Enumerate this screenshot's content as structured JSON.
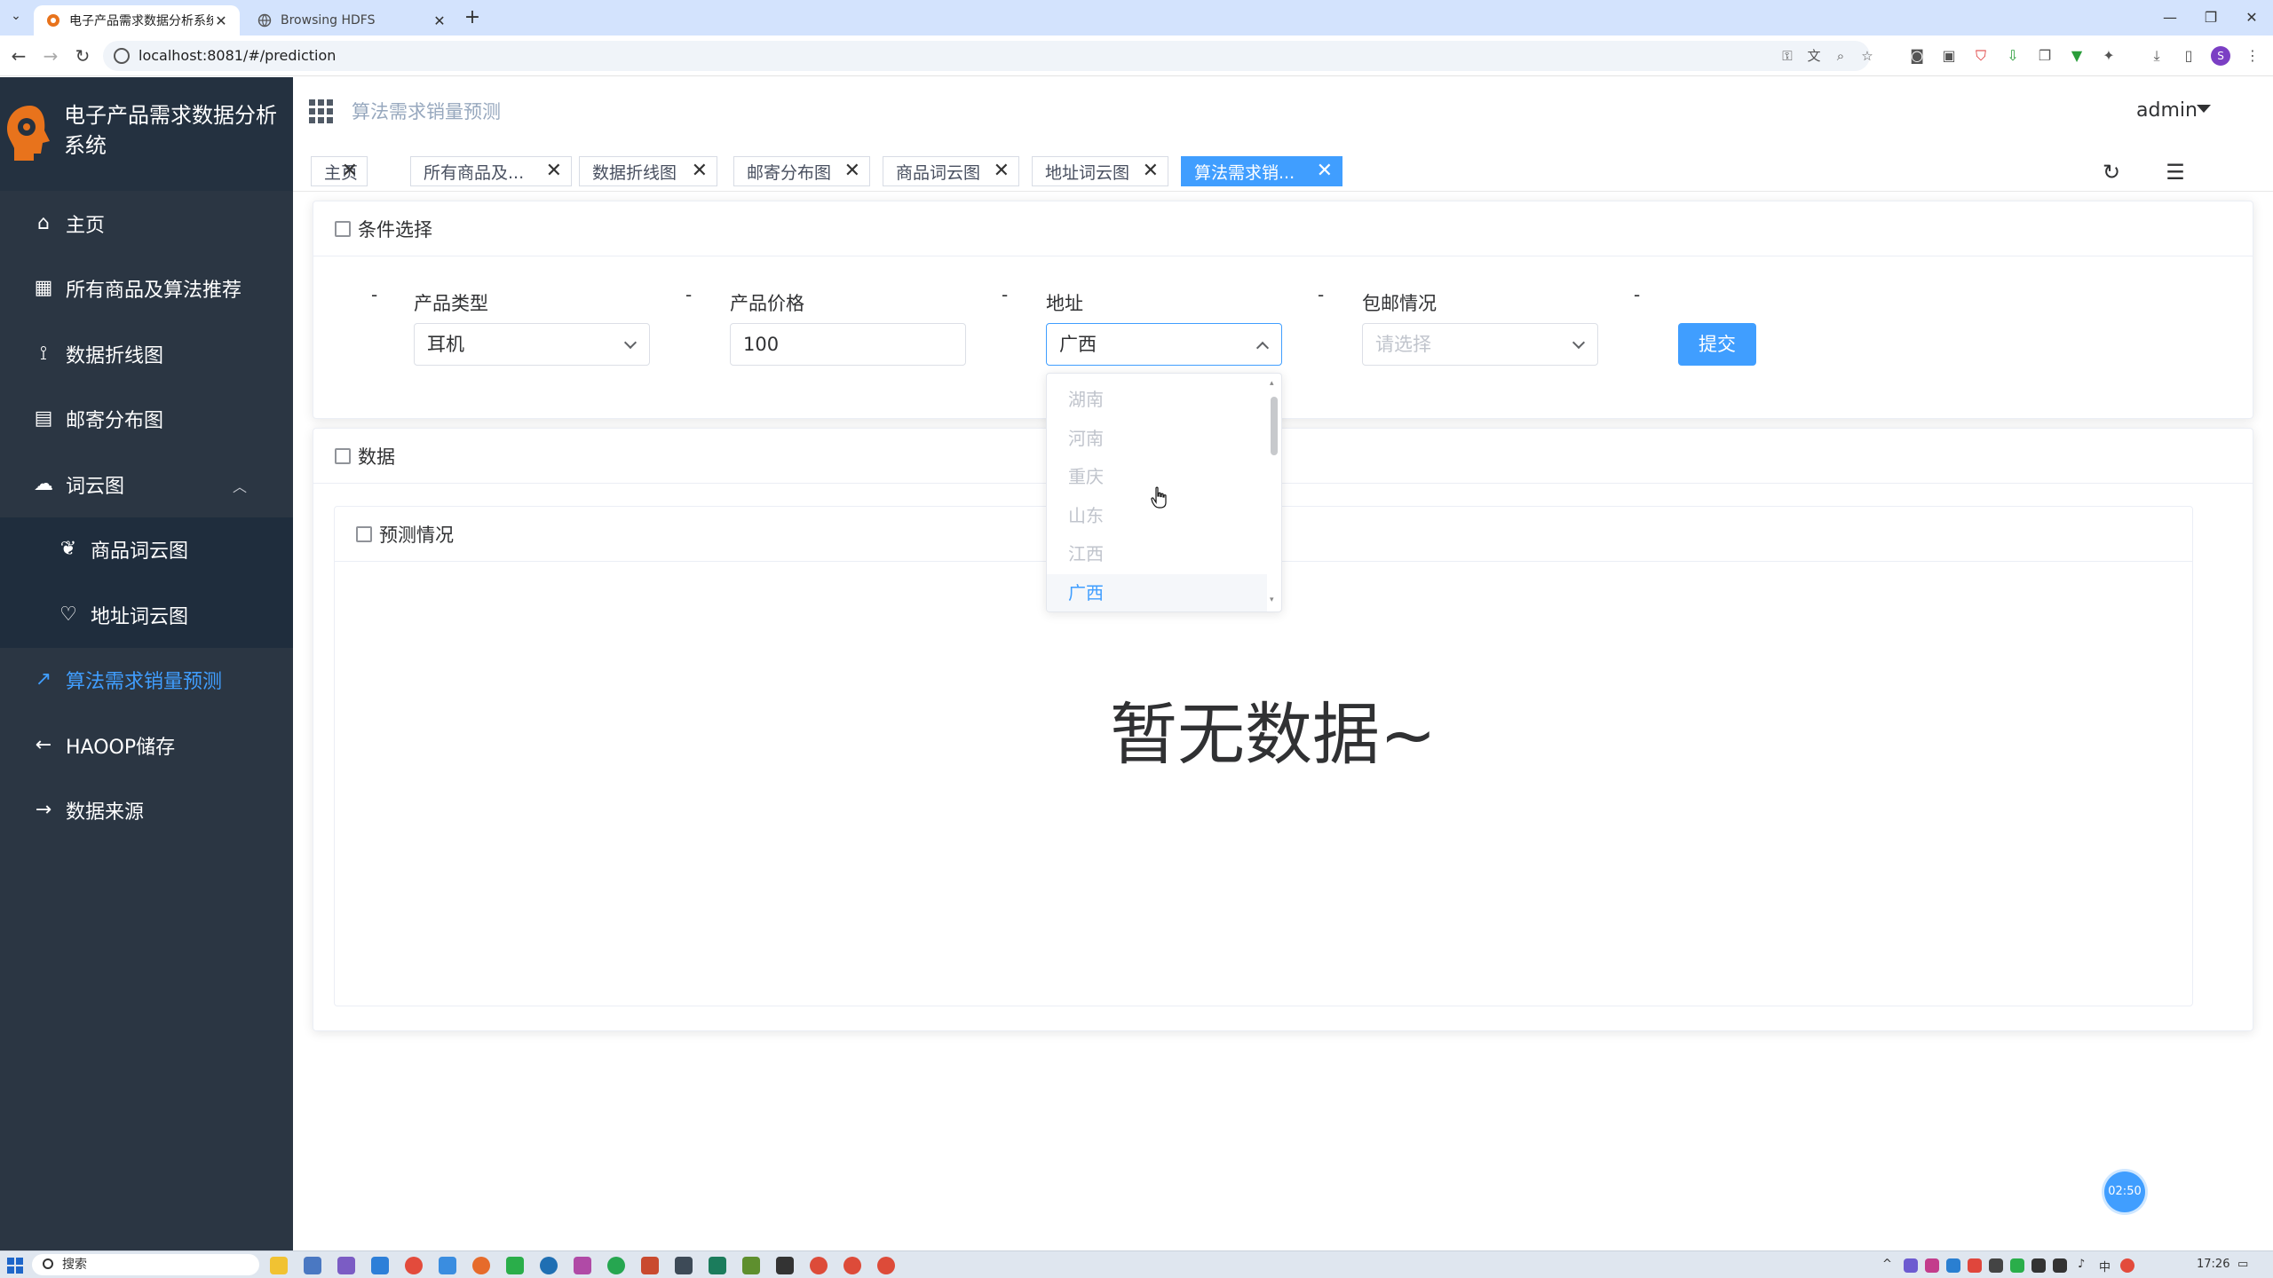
{
  "browser": {
    "tabs": [
      {
        "title": "电子产品需求数据分析系统 - 算",
        "active": true
      },
      {
        "title": "Browsing HDFS",
        "active": false
      }
    ],
    "url": "localhost:8081/#/prediction"
  },
  "app": {
    "title": "电子产品需求数据分析系统",
    "breadcrumb": "算法需求销量预测",
    "user": "admin"
  },
  "sidebar": {
    "items": [
      {
        "label": "主页",
        "icon": "home-icon"
      },
      {
        "label": "所有商品及算法推荐",
        "icon": "grid-icon"
      },
      {
        "label": "数据折线图",
        "icon": "share-icon"
      },
      {
        "label": "邮寄分布图",
        "icon": "box-icon"
      },
      {
        "label": "词云图",
        "icon": "cloud-icon"
      },
      {
        "label": "商品词云图",
        "icon": "leaf-icon"
      },
      {
        "label": "地址词云图",
        "icon": "heart-icon"
      },
      {
        "label": "算法需求销量预测",
        "icon": "trend-icon"
      },
      {
        "label": "HAOOP储存",
        "icon": "arrow-left-icon"
      },
      {
        "label": "数据来源",
        "icon": "arrow-right-icon"
      }
    ]
  },
  "tags": [
    "主页",
    "所有商品及...",
    "数据折线图",
    "邮寄分布图",
    "商品词云图",
    "地址词云图",
    "算法需求销..."
  ],
  "conditions": {
    "header": "条件选择",
    "type_label": "产品类型",
    "type_value": "耳机",
    "price_label": "产品价格",
    "price_value": "100",
    "address_label": "地址",
    "address_value": "广西",
    "shipping_label": "包邮情况",
    "shipping_placeholder": "请选择",
    "submit": "提交",
    "dash": "-"
  },
  "address_options": [
    "湖南",
    "河南",
    "重庆",
    "山东",
    "江西",
    "广西"
  ],
  "data_card": {
    "header": "数据",
    "inner_header": "预测情况",
    "empty_text": "暂无数据~"
  },
  "timer": "02:50",
  "taskbar": {
    "search": "搜索",
    "ime": "中",
    "time": "17:26"
  },
  "colors": {
    "accent": "#409eff",
    "sidebar_bg": "#2b3643",
    "submenu_bg": "#1f2d3d"
  }
}
